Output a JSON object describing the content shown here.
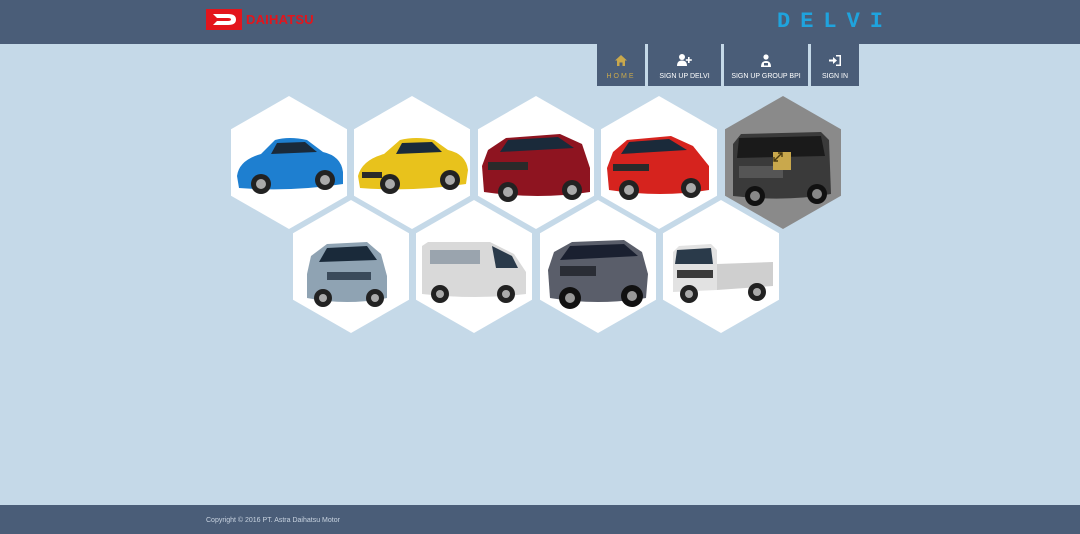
{
  "header": {
    "logo_text": "DAIHATSU",
    "brand": "DELVI"
  },
  "nav": {
    "items": [
      {
        "label": "HOME",
        "icon": "home-icon",
        "active": true
      },
      {
        "label": "SIGN UP DELVI",
        "icon": "user-plus-icon"
      },
      {
        "label": "SIGN UP GROUP BPI",
        "icon": "group-icon"
      },
      {
        "label": "SIGN IN",
        "icon": "sign-in-icon"
      }
    ]
  },
  "cars": [
    {
      "name": "copen-blue",
      "color": "#1e7fd0"
    },
    {
      "name": "copen-yellow",
      "color": "#e8c21c"
    },
    {
      "name": "xenia-red",
      "color": "#8e1420"
    },
    {
      "name": "ayla-red",
      "color": "#d6231e"
    },
    {
      "name": "luxio-black",
      "color": "#3a3a3a"
    },
    {
      "name": "sirion-silver",
      "color": "#8fa3b3"
    },
    {
      "name": "gran-max-van",
      "color": "#d9d9d9"
    },
    {
      "name": "terios-gray",
      "color": "#5a5e6a"
    },
    {
      "name": "gran-max-pickup",
      "color": "#e2e2e2"
    }
  ],
  "footer": {
    "copyright": "Copyright © 2016 PT. Astra Daihatsu Motor"
  },
  "colors": {
    "header_bg": "#4a5d78",
    "page_bg": "#c5d9e8",
    "accent": "#c9a84c",
    "logo_red": "#e3151c",
    "brand_blue": "#1fa3dd"
  }
}
